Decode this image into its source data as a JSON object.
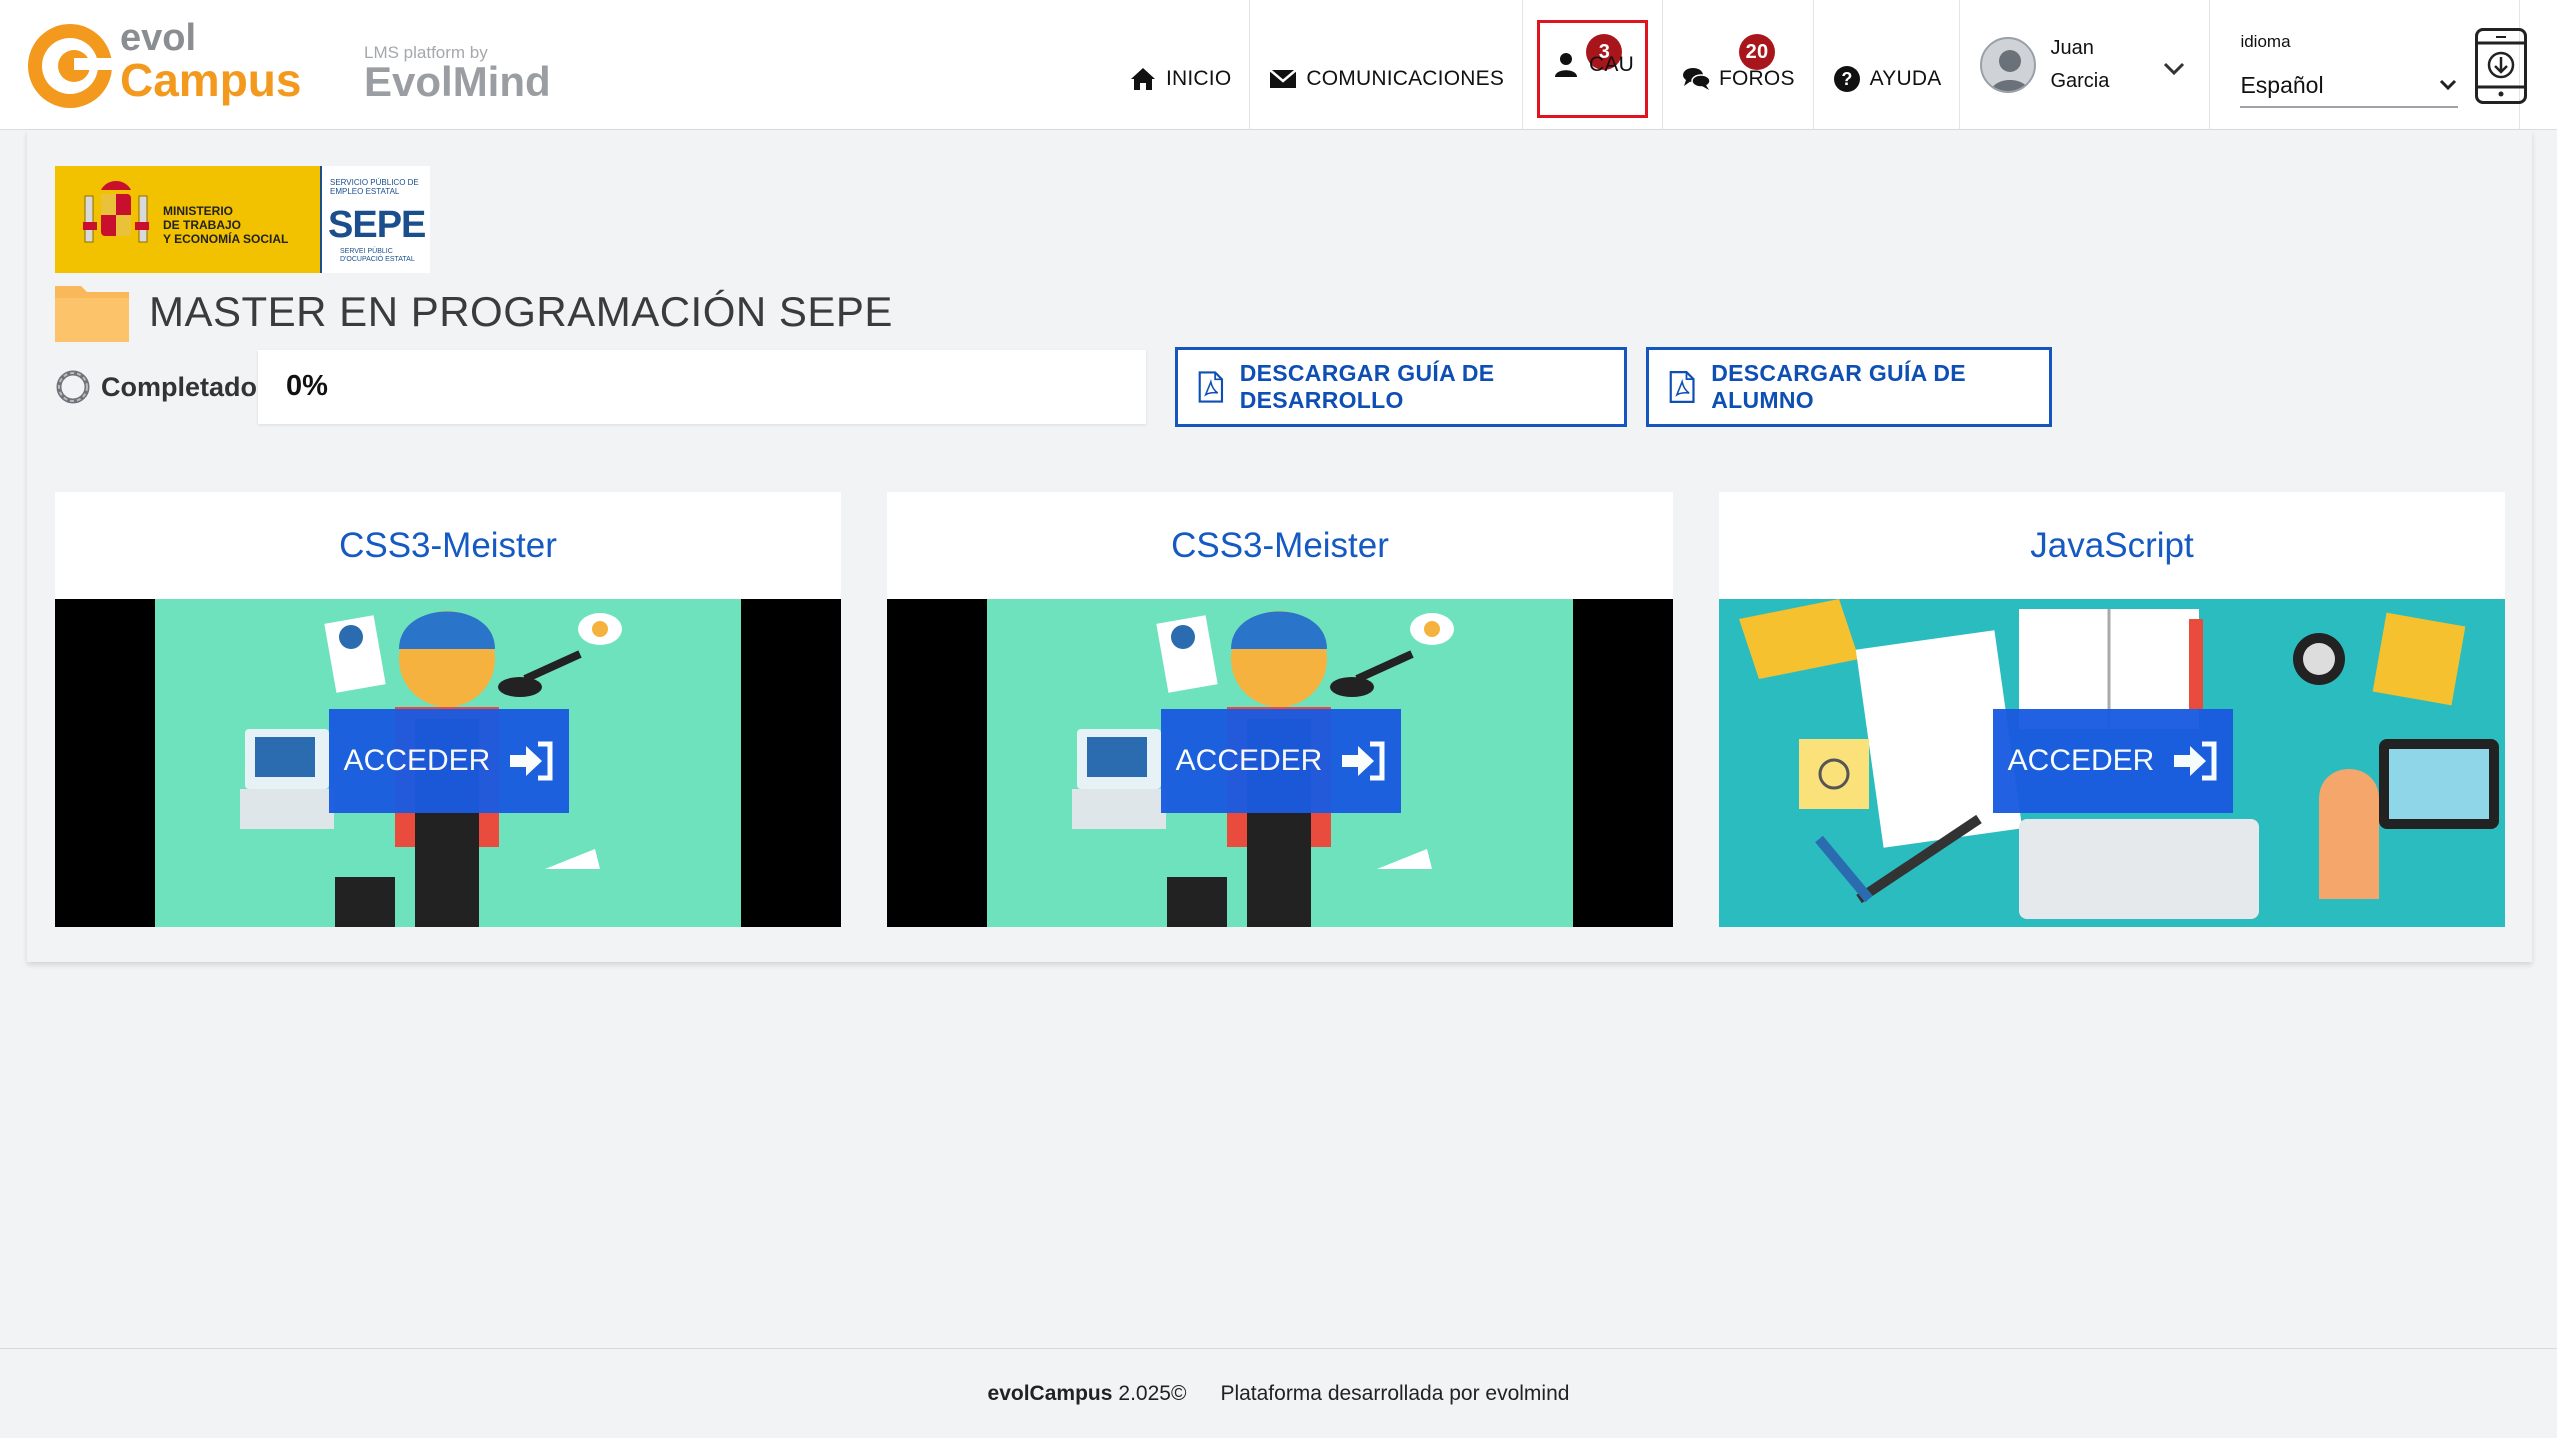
{
  "header": {
    "logo_evol": "evol",
    "logo_campus": "Campus",
    "logo_tagline": "LMS platform by",
    "logo_evolmind": "EvolMind",
    "nav": [
      {
        "label": "INICIO",
        "icon": "home-icon"
      },
      {
        "label": "COMUNICACIONES",
        "icon": "envelope-icon",
        "badge": "3"
      },
      {
        "label": "CAU",
        "icon": "user-icon"
      },
      {
        "label": "FOROS",
        "icon": "chat-icon",
        "badge": "20"
      },
      {
        "label": "AYUDA",
        "icon": "help-icon"
      }
    ],
    "user": {
      "first_name": "Juan",
      "last_name": "Garcia"
    },
    "language": {
      "label": "idioma",
      "value": "Español"
    }
  },
  "sponsor": {
    "ministerio": [
      "MINISTERIO",
      "DE TRABAJO",
      "Y ECONOMÍA SOCIAL"
    ],
    "sepe_top": "SERVICIO PÚBLICO DE EMPLEO ESTATAL",
    "sepe": "SEPE",
    "sepe_bottom": "SERVEI PÚBLIC D'OCUPACIÓ ESTATAL"
  },
  "course": {
    "title": "MASTER EN PROGRAMACIÓN SEPE",
    "completed_label": "Completado",
    "progress_percent": 0,
    "progress_text": "0%",
    "guide_dev_button": "DESCARGAR GUÍA DE DESARROLLO",
    "guide_student_button": "DESCARGAR GUÍA DE ALUMNO"
  },
  "modules": [
    {
      "title": "CSS3-Meister",
      "button": "ACCEDER",
      "image": "multitask-illustration"
    },
    {
      "title": "CSS3-Meister",
      "button": "ACCEDER",
      "image": "multitask-illustration"
    },
    {
      "title": "JavaScript",
      "button": "ACCEDER",
      "image": "desk-illustration"
    }
  ],
  "footer": {
    "brand": "evolCampus",
    "version": "2.025©",
    "credit": "Plataforma desarrollada por evolmind"
  },
  "colors": {
    "accent_blue": "#1a5be0",
    "logo_orange": "#f39a1e",
    "badge_red": "#a8161c",
    "highlight_red": "#e0141e",
    "card_teal": "#6ee2bd",
    "desk_teal": "#2bbcc0"
  }
}
